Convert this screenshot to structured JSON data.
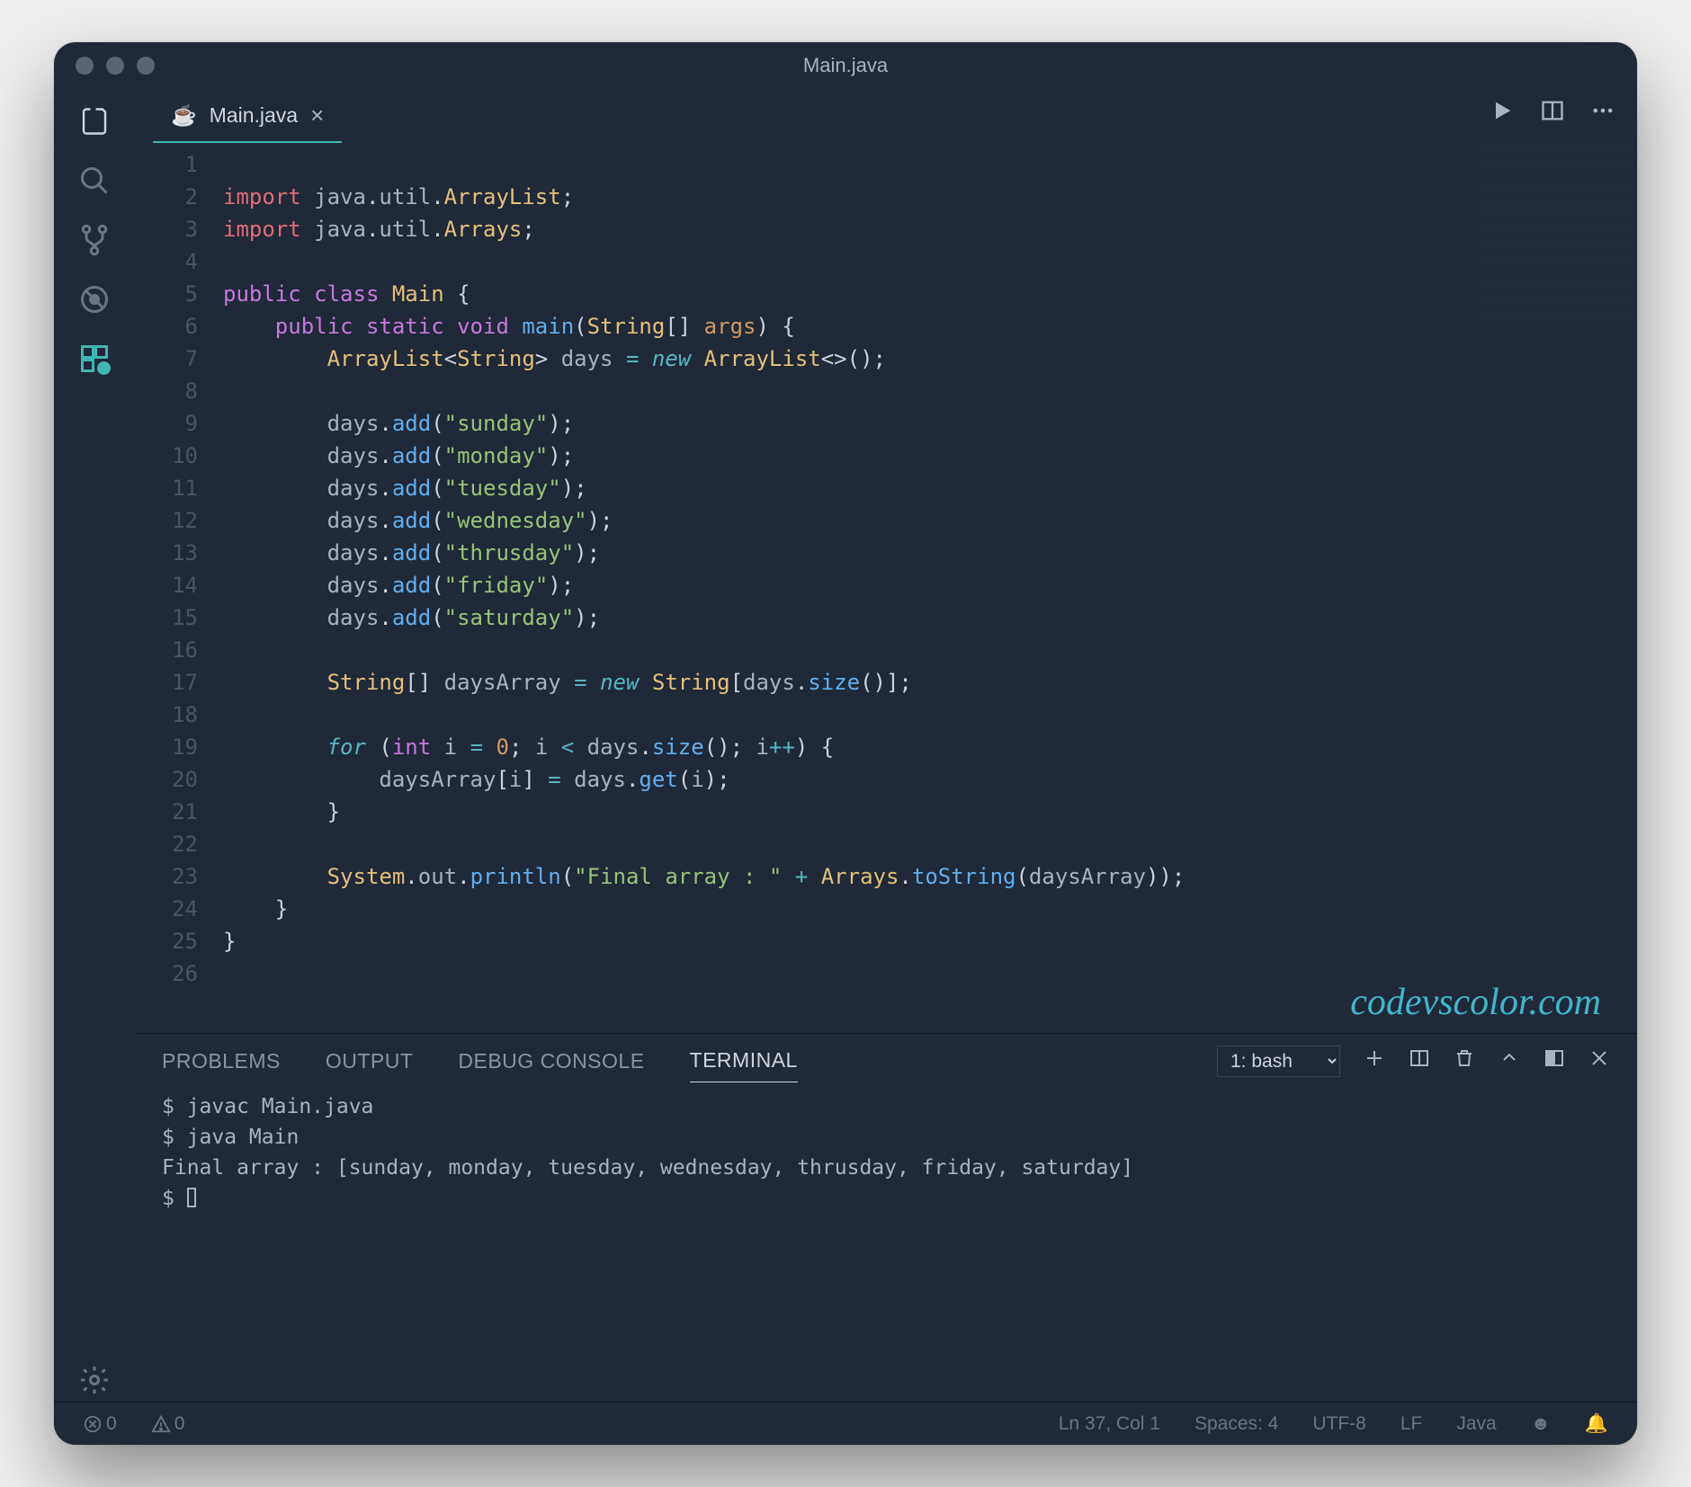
{
  "window": {
    "title": "Main.java"
  },
  "tab": {
    "filename": "Main.java"
  },
  "lineNumbers": [
    "1",
    "2",
    "3",
    "4",
    "5",
    "6",
    "7",
    "8",
    "9",
    "10",
    "11",
    "12",
    "13",
    "14",
    "15",
    "16",
    "17",
    "18",
    "19",
    "20",
    "21",
    "22",
    "23",
    "24",
    "25",
    "26"
  ],
  "code": {
    "imports": [
      "java.util.ArrayList",
      "java.util.Arrays"
    ],
    "className": "Main",
    "method": "main",
    "paramType": "String[]",
    "paramName": "args",
    "listVar": "days",
    "listType": "ArrayList<String>",
    "addCalls": [
      "sunday",
      "monday",
      "tuesday",
      "wednesday",
      "thrusday",
      "friday",
      "saturday"
    ],
    "arrayVar": "daysArray",
    "arrayType": "String",
    "printLabel": "Final array : "
  },
  "panel": {
    "tabs": [
      "PROBLEMS",
      "OUTPUT",
      "DEBUG CONSOLE",
      "TERMINAL"
    ],
    "activeTab": "TERMINAL",
    "terminalSelect": "1: bash",
    "lines": [
      "$ javac Main.java",
      "$ java Main",
      "Final array : [sunday, monday, tuesday, wednesday, thrusday, friday, saturday]",
      "$ "
    ]
  },
  "status": {
    "errors": "0",
    "warnings": "0",
    "cursor": "Ln 37, Col 1",
    "spaces": "Spaces: 4",
    "encoding": "UTF-8",
    "eol": "LF",
    "lang": "Java"
  },
  "watermark": "codevscolor.com"
}
